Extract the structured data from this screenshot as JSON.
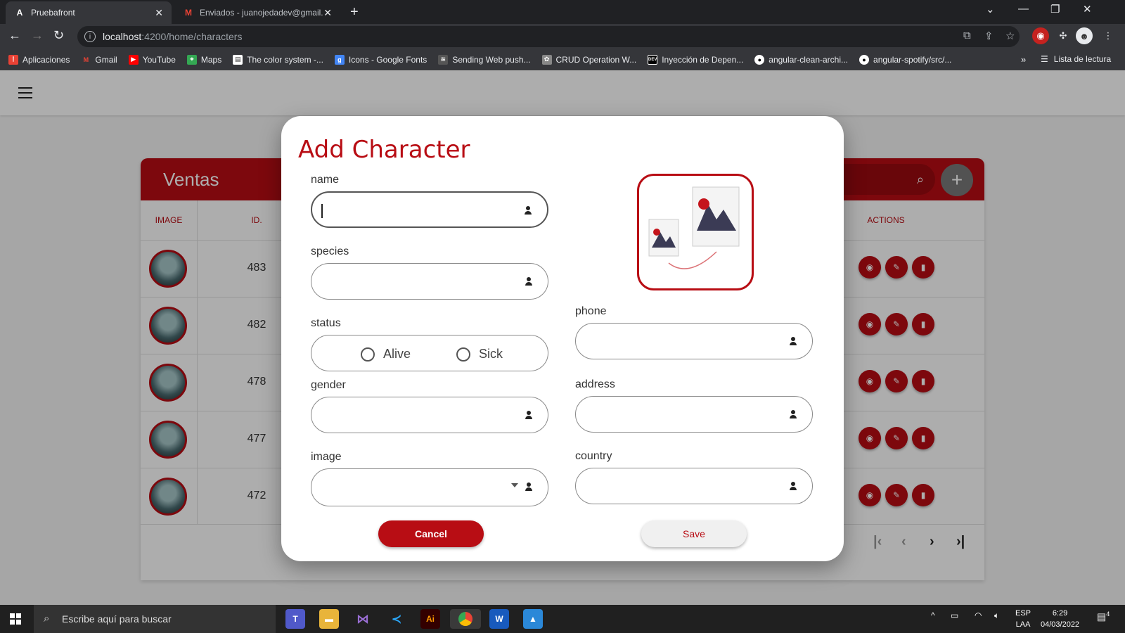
{
  "browser": {
    "tabs": [
      {
        "title": "Pruebafront",
        "icon": "angular-icon"
      },
      {
        "title": "Enviados - juanojedadev@gmail.",
        "icon": "gmail-icon"
      }
    ],
    "url_host": "localhost",
    "url_rest": ":4200/home/characters",
    "bookmarks": [
      {
        "label": "Aplicaciones",
        "icon": "apps-grid-icon",
        "color": "#e94235"
      },
      {
        "label": "Gmail",
        "icon": "gmail-icon",
        "color": "#ea4335"
      },
      {
        "label": "YouTube",
        "icon": "youtube-icon",
        "color": "#ff0000"
      },
      {
        "label": "Maps",
        "icon": "maps-icon",
        "color": "#34a853"
      },
      {
        "label": "The color system -...",
        "icon": "doc-icon",
        "color": "#ffffff"
      },
      {
        "label": "Icons - Google Fonts",
        "icon": "google-fonts-icon",
        "color": "#4285f4"
      },
      {
        "label": "Sending Web push...",
        "icon": "web-icon",
        "color": "#555555"
      },
      {
        "label": "CRUD Operation W...",
        "icon": "crud-icon",
        "color": "#888888"
      },
      {
        "label": "Inyección de Depen...",
        "icon": "dev-icon",
        "color": "#000000"
      },
      {
        "label": "angular-clean-archi...",
        "icon": "github-icon",
        "color": "#ffffff"
      },
      {
        "label": "angular-spotify/src/...",
        "icon": "github-icon",
        "color": "#ffffff"
      }
    ],
    "reading_list": "Lista de lectura"
  },
  "app": {
    "card_title": "Ventas",
    "columns": {
      "image": "IMAGE",
      "id": "ID.",
      "actions": "ACTIONS"
    },
    "rows": [
      {
        "id": "483"
      },
      {
        "id": "482"
      },
      {
        "id": "478"
      },
      {
        "id": "477"
      },
      {
        "id": "472"
      }
    ]
  },
  "dialog": {
    "title": "Add Character",
    "labels": {
      "name": "name",
      "species": "species",
      "status": "status",
      "gender": "gender",
      "image": "image",
      "phone": "phone",
      "address": "address",
      "country": "country"
    },
    "status_options": [
      "Alive",
      "Sick"
    ],
    "cancel_label": "Cancel",
    "save_label": "Save"
  },
  "taskbar": {
    "search_placeholder": "Escribe aquí para buscar",
    "lang": "ESP",
    "layout": "LAA",
    "time": "6:29",
    "date": "04/03/2022",
    "notifications": "4"
  },
  "colors": {
    "accent": "#b80d14"
  }
}
